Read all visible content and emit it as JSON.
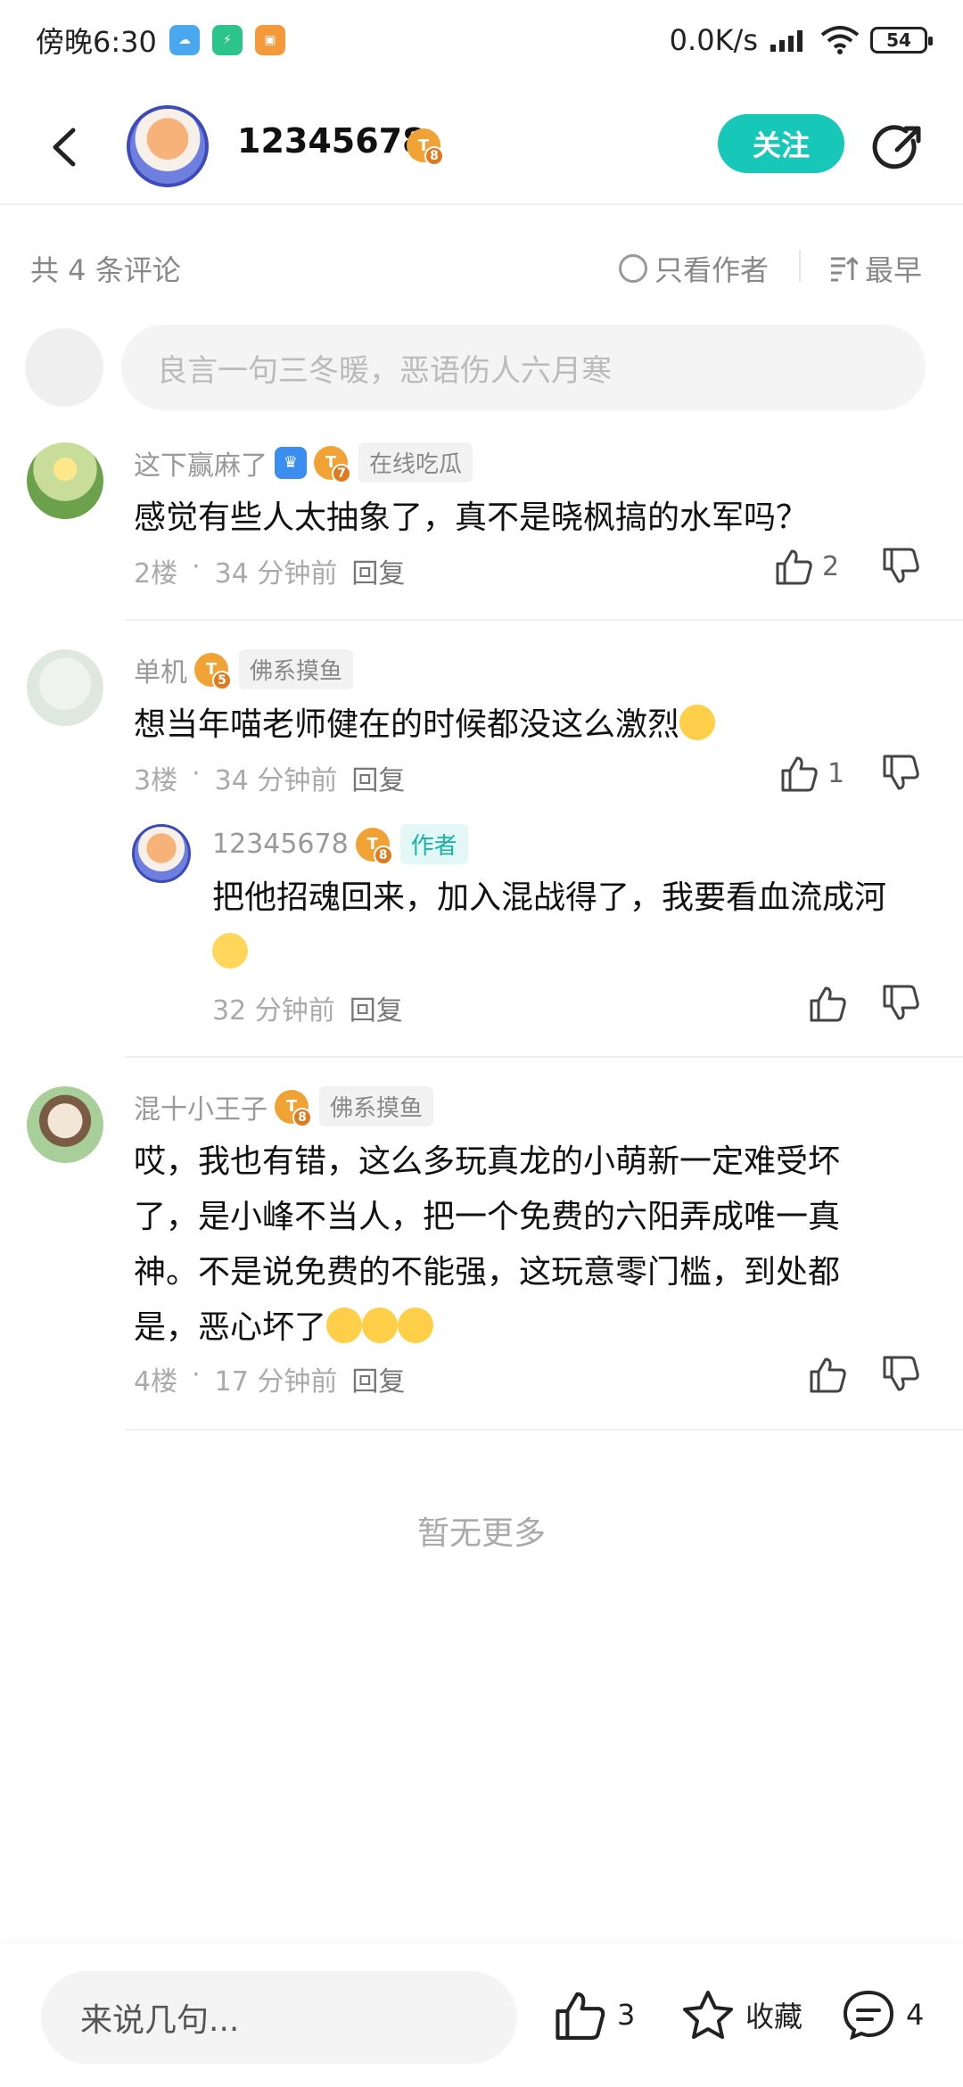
{
  "status_bar": {
    "time": "傍晚6:30",
    "network_speed": "0.0K/s",
    "battery": "54"
  },
  "header": {
    "username": "12345678",
    "level": "8",
    "follow_label": "关注"
  },
  "toolbar": {
    "total": "共 4 条评论",
    "author_only": "只看作者",
    "sort": "最早"
  },
  "input": {
    "placeholder": "良言一句三冬暖，恶语伤人六月寒"
  },
  "comments": [
    {
      "name": "这下赢麻了",
      "level": "7",
      "tag": "在线吃瓜",
      "text": "感觉有些人太抽象了，真不是晓枫搞的水军吗？",
      "floor": "2楼",
      "time": "34 分钟前",
      "reply_label": "回复",
      "likes": "2"
    },
    {
      "name": "单机",
      "level": "5",
      "tag": "佛系摸鱼",
      "text": "想当年喵老师健在的时候都没这么激烈",
      "floor": "3楼",
      "time": "34 分钟前",
      "reply_label": "回复",
      "likes": "1",
      "reply": {
        "name": "12345678",
        "level": "8",
        "tag": "作者",
        "text": "把他招魂回来，加入混战得了，我要看血流成河",
        "time": "32 分钟前",
        "reply_label": "回复"
      }
    },
    {
      "name": "混十小王子",
      "level": "8",
      "tag": "佛系摸鱼",
      "text": "哎，我也有错，这么多玩真龙的小萌新一定难受坏了，是小峰不当人，把一个免费的六阳弄成唯一真神。不是说免费的不能强，这玩意零门槛，到处都是，恶心坏了",
      "floor": "4楼",
      "time": "17 分钟前",
      "reply_label": "回复"
    }
  ],
  "no_more": "暂无更多",
  "bottom_bar": {
    "input_placeholder": "来说几句...",
    "likes": "3",
    "favorite_label": "收藏",
    "comments": "4"
  },
  "colors": {
    "accent": "#17c8b8",
    "badge": "#f0a235"
  }
}
